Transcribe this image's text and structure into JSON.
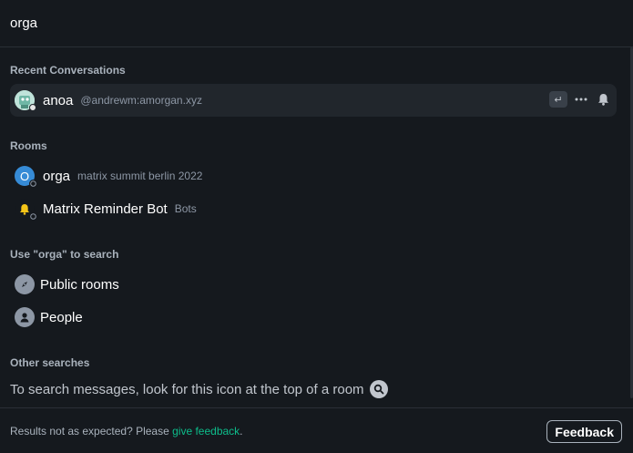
{
  "search": {
    "value": "orga"
  },
  "recent": {
    "title": "Recent Conversations",
    "items": [
      {
        "name": "anoa",
        "handle": "@andrewm:amorgan.xyz",
        "enter_glyph": "↵"
      }
    ]
  },
  "rooms": {
    "title": "Rooms",
    "items": [
      {
        "name": "orga",
        "desc": "matrix summit berlin 2022",
        "avatar_letter": "O",
        "avatar_color": "#368bd6"
      },
      {
        "name": "Matrix Reminder Bot",
        "desc": "Bots",
        "avatar_letter": "🔔",
        "avatar_color": "#15191e"
      }
    ]
  },
  "use_search": {
    "title": "Use \"orga\" to search",
    "options": [
      {
        "label": "Public rooms",
        "icon": "compass-icon"
      },
      {
        "label": "People",
        "icon": "person-icon"
      }
    ]
  },
  "other": {
    "title": "Other searches",
    "tip": "To search messages, look for this icon at the top of a room"
  },
  "footer": {
    "text": "Results not as expected? Please ",
    "link": "give feedback",
    "suffix": ".",
    "button": "Feedback"
  },
  "colors": {
    "accent": "#0dbd8b",
    "background": "#15191e",
    "selected": "#21262c"
  }
}
